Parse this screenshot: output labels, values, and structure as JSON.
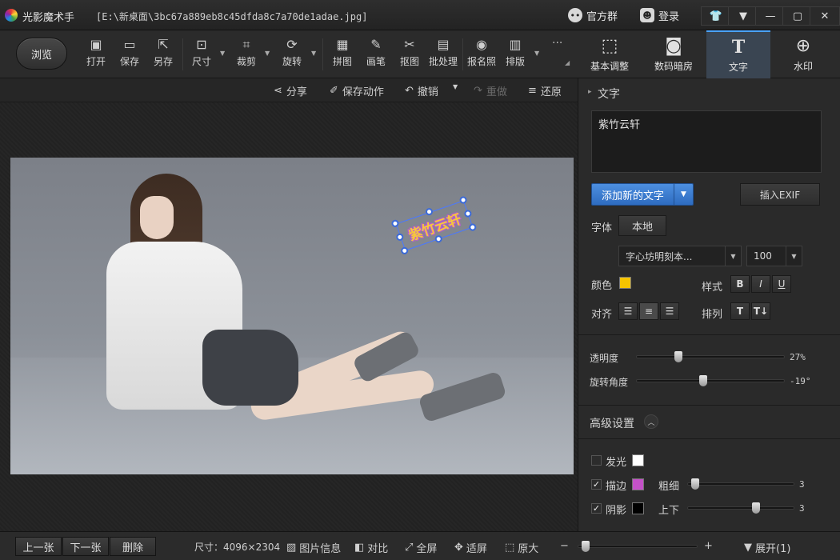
{
  "app": {
    "name": "光影魔术手",
    "file_path": "[E:\\新桌面\\3bc67a889eb8c45dfda8c7a70de1adae.jpg]"
  },
  "titlebar": {
    "group_label": "官方群",
    "login_label": "登录",
    "window_buttons": [
      "👕",
      "▼",
      "—",
      "▢",
      "✕"
    ]
  },
  "toolbar": {
    "browse_label": "浏览",
    "tools": [
      {
        "label": "打开",
        "icon": "image-open-icon"
      },
      {
        "label": "保存",
        "icon": "save-icon"
      },
      {
        "label": "另存",
        "icon": "save-as-icon"
      },
      {
        "label": "尺寸",
        "icon": "resize-icon"
      },
      {
        "label": "裁剪",
        "icon": "crop-icon"
      },
      {
        "label": "旋转",
        "icon": "rotate-icon"
      },
      {
        "label": "拼图",
        "icon": "collage-icon"
      },
      {
        "label": "画笔",
        "icon": "brush-icon"
      },
      {
        "label": "抠图",
        "icon": "cutout-icon"
      },
      {
        "label": "批处理",
        "icon": "batch-icon"
      },
      {
        "label": "报名照",
        "icon": "id-photo-icon"
      },
      {
        "label": "排版",
        "icon": "layout-icon"
      }
    ],
    "more": "···"
  },
  "right_tabs": [
    {
      "label": "基本调整",
      "icon": "adjust-icon"
    },
    {
      "label": "数码暗房",
      "icon": "camera-icon"
    },
    {
      "label": "文字",
      "icon": "text-icon",
      "active": true
    },
    {
      "label": "水印",
      "icon": "watermark-icon"
    }
  ],
  "actions": {
    "share": "分享",
    "save_action": "保存动作",
    "undo": "撤销",
    "redo": "重做",
    "restore": "还原"
  },
  "canvas": {
    "overlay_text": "紫竹云轩"
  },
  "panel": {
    "section_title": "文字",
    "text_value": "紫竹云轩",
    "add_text": "添加新的文字",
    "insert_exif": "插入EXIF",
    "font_label": "字体",
    "font_source": "本地",
    "font_name": "字心坊明刻本...",
    "font_size": "100",
    "color_label": "颜色",
    "text_color": "#f5c400",
    "style_label": "样式",
    "style_buttons": [
      "B",
      "I",
      "U"
    ],
    "align_label": "对齐",
    "arrange_label": "排列",
    "opacity_label": "透明度",
    "opacity_value": "27%",
    "opacity_fraction": 0.27,
    "rotation_label": "旋转角度",
    "rotation_value": "-19°",
    "rotation_fraction": 0.45,
    "advanced_label": "高级设置",
    "glow_label": "发光",
    "glow_checked": false,
    "glow_color": "#ffffff",
    "stroke_label": "描边",
    "stroke_checked": true,
    "stroke_color": "#c451c8",
    "thickness_label": "粗细",
    "thickness_value": "3",
    "shadow_label": "阴影",
    "shadow_checked": true,
    "shadow_color": "#000000",
    "updown_label": "上下",
    "updown_value": "3"
  },
  "statusbar": {
    "prev": "上一张",
    "next": "下一张",
    "delete": "删除",
    "size": "尺寸：4096×2304",
    "info": "图片信息",
    "compare": "对比",
    "fullscreen": "全屏",
    "fit": "适屏",
    "original": "原大",
    "expand": "展开(1)"
  }
}
